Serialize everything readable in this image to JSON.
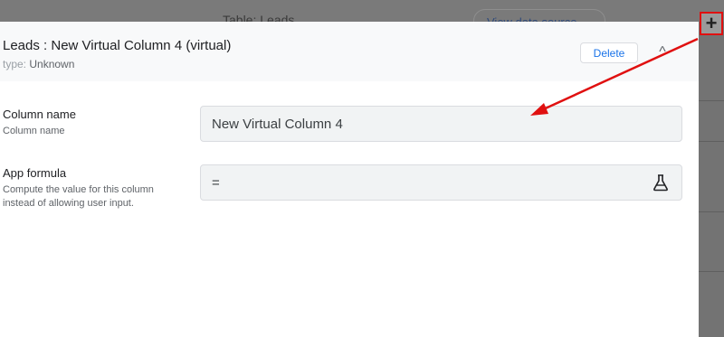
{
  "background": {
    "table_title": "Table: Leads",
    "view_button_label": "View data source"
  },
  "panel": {
    "title": "Leads : New Virtual Column 4 (virtual)",
    "type_key": "type:",
    "type_value": "Unknown",
    "delete_label": "Delete",
    "collapse_icon": "^"
  },
  "fields": {
    "column_name": {
      "label": "Column name",
      "description": "Column name",
      "value": "New Virtual Column 4"
    },
    "app_formula": {
      "label": "App formula",
      "description": "Compute the value for this column instead of allowing user input.",
      "value": "="
    }
  },
  "add_button": {
    "label": "+"
  },
  "colors": {
    "highlight": "#e01010",
    "accent": "#1a73e8"
  }
}
